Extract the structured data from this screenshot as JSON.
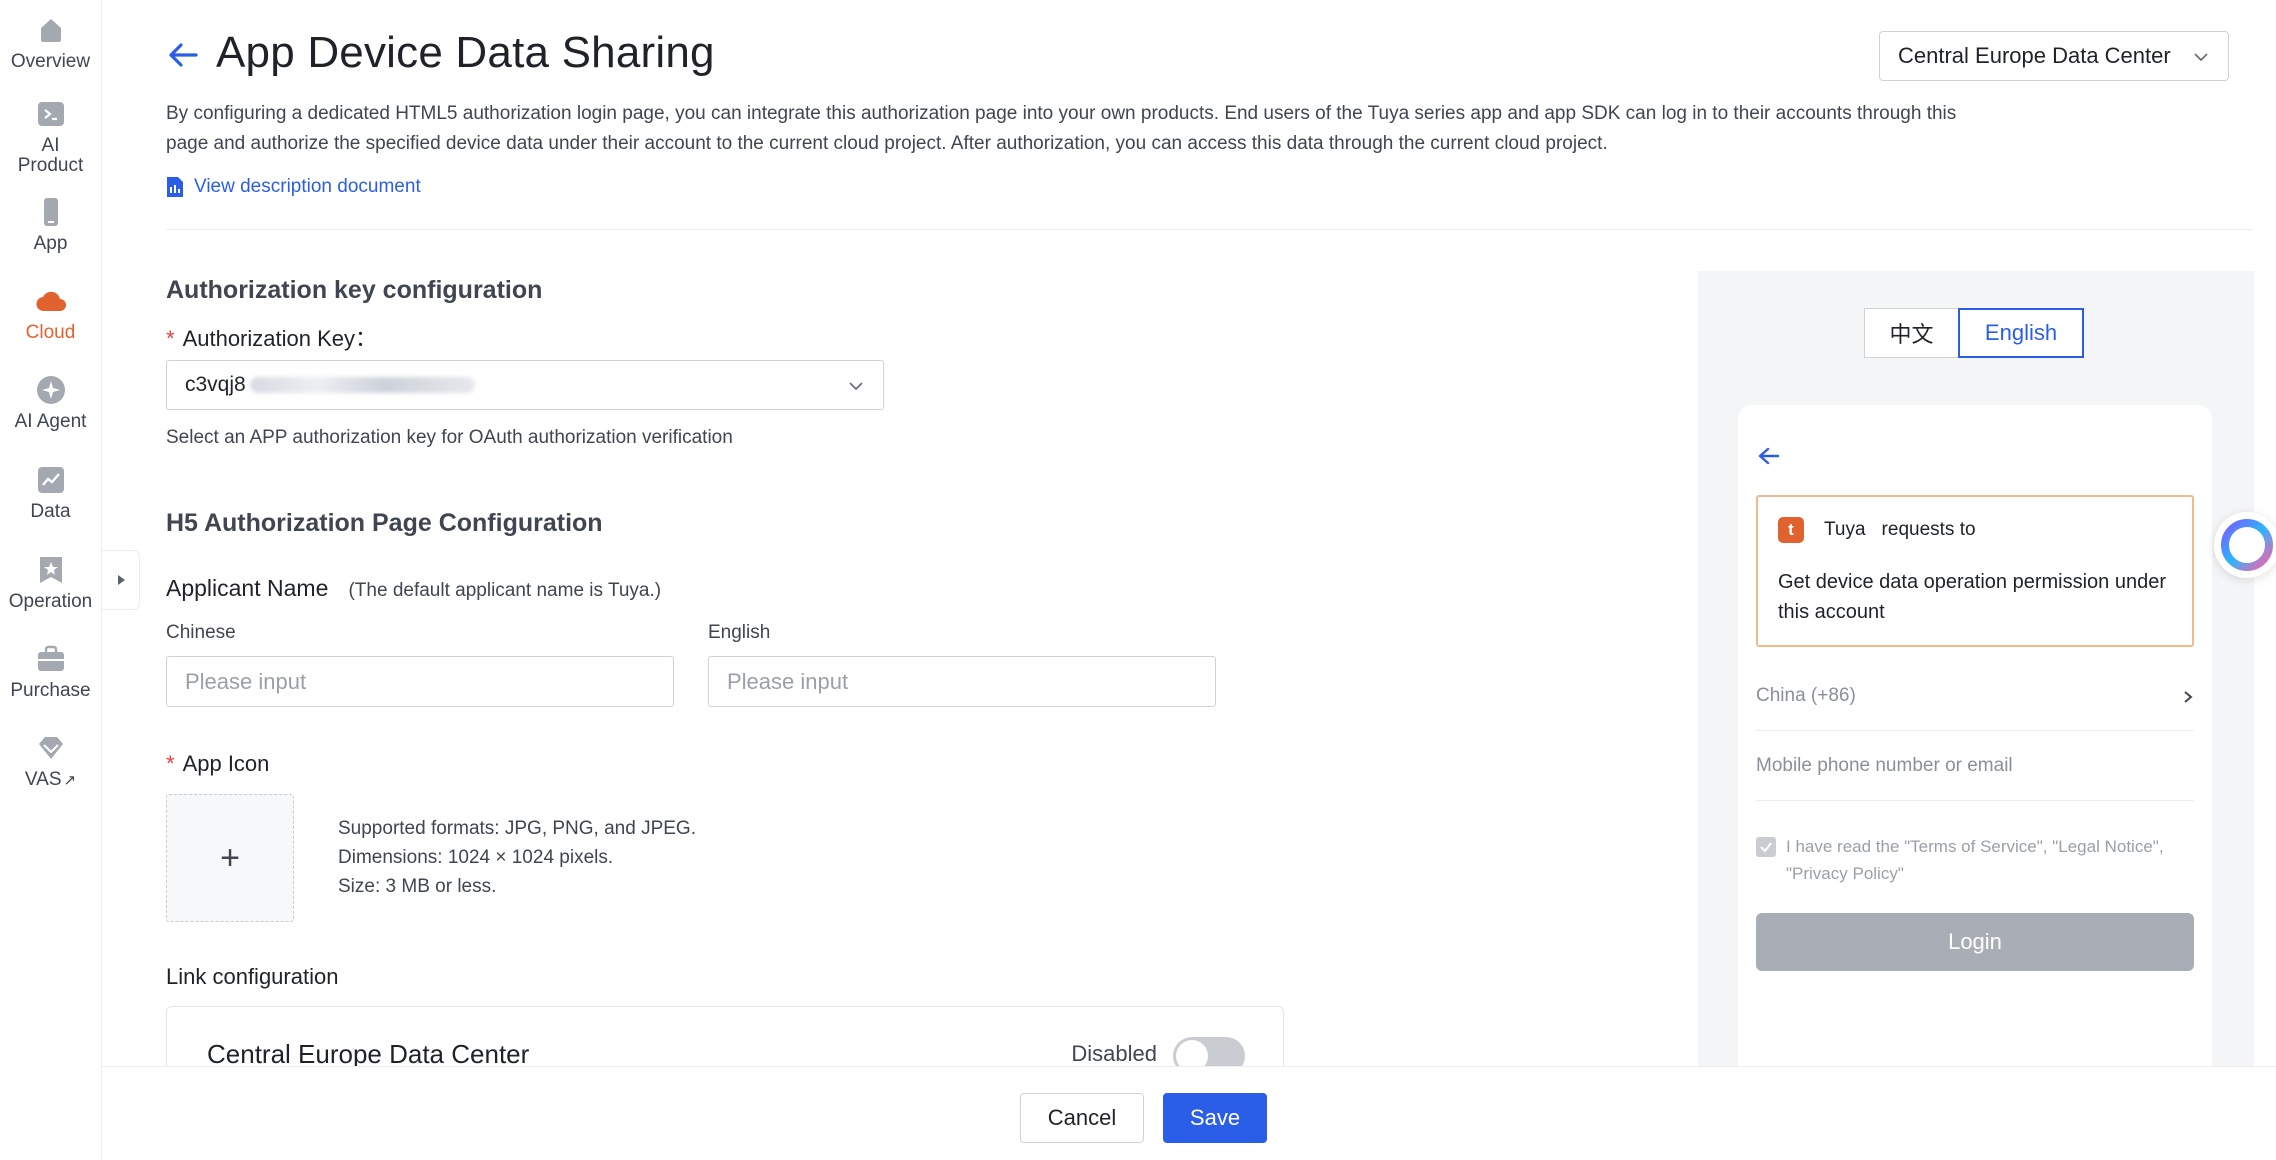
{
  "sidebar": {
    "items": [
      {
        "label": "Overview",
        "icon": "home-icon"
      },
      {
        "label": "AI Product",
        "icon": "terminal-icon"
      },
      {
        "label": "App",
        "icon": "phone-icon"
      },
      {
        "label": "Cloud",
        "icon": "cloud-icon",
        "active": true
      },
      {
        "label": "AI Agent",
        "icon": "sparkle-icon"
      },
      {
        "label": "Data",
        "icon": "chart-icon"
      },
      {
        "label": "Operation",
        "icon": "star-badge-icon"
      },
      {
        "label": "Purchase",
        "icon": "cart-icon"
      },
      {
        "label": "VAS",
        "icon": "diamond-icon",
        "suffix": "↗"
      }
    ]
  },
  "header": {
    "title": "App Device Data Sharing",
    "region": "Central Europe Data Center",
    "description": "By configuring a dedicated HTML5 authorization login page, you can integrate this authorization page into your own products. End users of the Tuya series app and app SDK can log in to their accounts through this page and authorize the specified device data under their account to the current cloud project. After authorization, you can access this data through the current cloud project.",
    "doc_link": "View description document"
  },
  "auth": {
    "section_title": "Authorization key configuration",
    "key_label": "Authorization Key：",
    "key_value_prefix": "c3vqj8",
    "key_hint": "Select an APP authorization key for OAuth authorization verification"
  },
  "h5": {
    "section_title": "H5 Authorization Page Configuration",
    "applicant_label": "Applicant Name",
    "applicant_note": "(The default applicant name is Tuya.)",
    "chinese_label": "Chinese",
    "english_label": "English",
    "placeholder": "Please input",
    "icon_label": "App Icon",
    "upload_plus": "+",
    "formats": "Supported formats: JPG, PNG, and JPEG.",
    "dimensions": "Dimensions: 1024 × 1024 pixels.",
    "size": "Size: 3 MB or less."
  },
  "link": {
    "section_title": "Link configuration",
    "card_title": "Central Europe Data Center",
    "status": "Disabled",
    "enabled": false
  },
  "footer": {
    "cancel": "Cancel",
    "save": "Save"
  },
  "preview": {
    "lang_zh": "中文",
    "lang_en": "English",
    "brand": "Tuya",
    "brand_logo": "t",
    "requests": "requests to",
    "permission": "Get device data operation permission under this account",
    "country": "China (+86)",
    "phone_placeholder": "Mobile phone number or email",
    "terms": "I have read the \"Terms of Service\", \"Legal Notice\", \"Privacy Policy\"",
    "login": "Login"
  },
  "colors": {
    "accent": "#2b5ee8",
    "active_nav": "#e0622f",
    "required": "#e43f3f"
  }
}
